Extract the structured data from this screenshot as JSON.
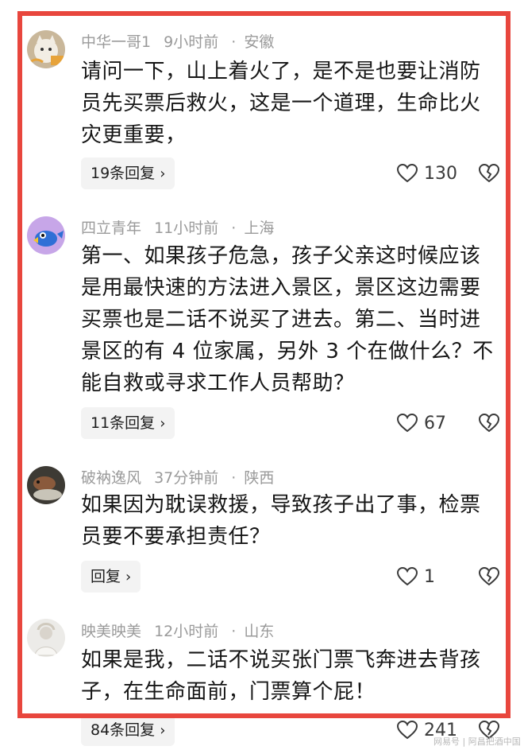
{
  "comments": [
    {
      "username": "中华一哥1",
      "time": "9小时前",
      "location": "安徽",
      "lines": [
        "请问一下，山上着火了，是不是也要让消防",
        "员先买票后救火，这是一个道理，生命比火",
        "灾更重要，"
      ],
      "reply_label": "19条回复",
      "likes": "130",
      "avatar_icon": "cat-avatar"
    },
    {
      "username": "四立青年",
      "time": "11小时前",
      "location": "上海",
      "lines": [
        "第一、如果孩子危急，孩子父亲这时候应该",
        "是用最快速的方法进入景区，景区这边需要",
        "买票也是二话不说买了进去。第二、当时进",
        "景区的有 4 位家属，另外 3 个在做什么？不",
        "能自救或寻求工作人员帮助？"
      ],
      "reply_label": "11条回复",
      "likes": "67",
      "avatar_icon": "cartoon-bird-avatar"
    },
    {
      "username": "破衲逸风",
      "time": "37分钟前",
      "location": "陕西",
      "lines": [
        "如果因为耽误救援，导致孩子出了事，检票",
        "员要不要承担责任？"
      ],
      "reply_label": "回复",
      "likes": "1",
      "avatar_icon": "animal-photo-avatar"
    },
    {
      "username": "映美映美",
      "time": "12小时前",
      "location": "山东",
      "lines": [
        "如果是我，二话不说买张门票飞奔进去背孩",
        "子，在生命面前，门票算个屁！"
      ],
      "reply_label": "84条回复",
      "likes": "241",
      "avatar_icon": "person-avatar"
    }
  ],
  "separator": "·",
  "reply_chevron": "›",
  "watermark": "网易号 | 阿昌把酒中国",
  "colors": {
    "frame": "#e8463d",
    "meta": "#9a9a9a",
    "reply_bg": "#f3f3f3"
  }
}
